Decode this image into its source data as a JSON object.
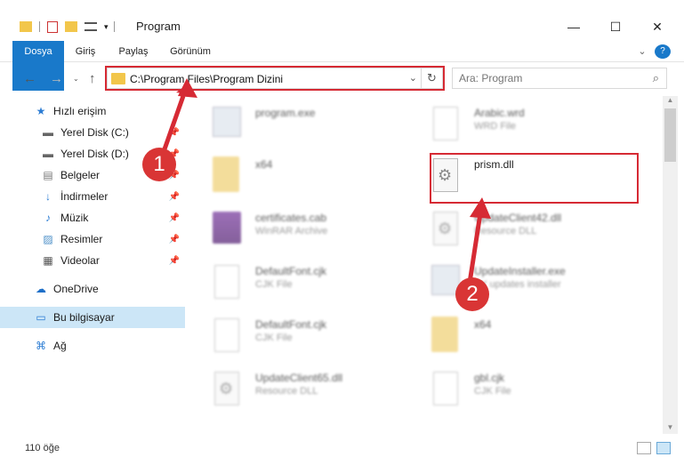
{
  "window": {
    "title": "Program",
    "minimize": "—",
    "maximize": "☐",
    "close": "✕"
  },
  "ribbon": {
    "tabs": [
      "Dosya",
      "Giriş",
      "Paylaş",
      "Görünüm"
    ],
    "expand": "⌄",
    "help": "?"
  },
  "address": {
    "path": "C:\\Program Files\\Program Dizini",
    "drop": "⌄",
    "refresh": "↻"
  },
  "search": {
    "placeholder": "Ara: Program",
    "icon": "⌕"
  },
  "sidebar": {
    "items": [
      {
        "label": "Hızlı erişim",
        "icon": "★",
        "pinned": false
      },
      {
        "label": "Yerel Disk (C:)",
        "icon": "▬",
        "pinned": true
      },
      {
        "label": "Yerel Disk (D:)",
        "icon": "▬",
        "pinned": true
      },
      {
        "label": "Belgeler",
        "icon": "▤",
        "pinned": true
      },
      {
        "label": "İndirmeler",
        "icon": "↓",
        "pinned": true
      },
      {
        "label": "Müzik",
        "icon": "♪",
        "pinned": true
      },
      {
        "label": "Resimler",
        "icon": "▨",
        "pinned": true
      },
      {
        "label": "Videolar",
        "icon": "▦",
        "pinned": true
      },
      {
        "label": "OneDrive",
        "icon": "☁",
        "pinned": false
      },
      {
        "label": "Bu bilgisayar",
        "icon": "▭",
        "pinned": false,
        "selected": true
      },
      {
        "label": "Ağ",
        "icon": "⌘",
        "pinned": false
      }
    ],
    "pin_glyph": "📌"
  },
  "files": [
    {
      "name": "program.exe",
      "type": "",
      "icon": "exe"
    },
    {
      "name": "Arabic.wrd",
      "type": "WRD File",
      "icon": "doc"
    },
    {
      "name": "x64",
      "type": "",
      "icon": "folder"
    },
    {
      "name": "prism.dll",
      "type": "",
      "icon": "dll"
    },
    {
      "name": "certificates.cab",
      "type": "WinRAR Archive",
      "icon": "rar"
    },
    {
      "name": "UpdateClient42.dll",
      "type": "Resource DLL",
      "icon": "dll"
    },
    {
      "name": "DefaultFont.cjk",
      "type": "CJK File",
      "icon": "doc"
    },
    {
      "name": "UpdateInstaller.exe",
      "type": "BY updates installer",
      "icon": "exe"
    },
    {
      "name": "DefaultFont.cjk",
      "type": "CJK File",
      "icon": "doc"
    },
    {
      "name": "x64",
      "type": "",
      "icon": "folder"
    },
    {
      "name": "UpdateClient65.dll",
      "type": "Resource DLL",
      "icon": "dll"
    },
    {
      "name": "gbl.cjk",
      "type": "CJK File",
      "icon": "doc"
    }
  ],
  "status": {
    "count": "110 öğe"
  },
  "annotations": {
    "step1": "1",
    "step2": "2",
    "color": "#d62a34"
  }
}
